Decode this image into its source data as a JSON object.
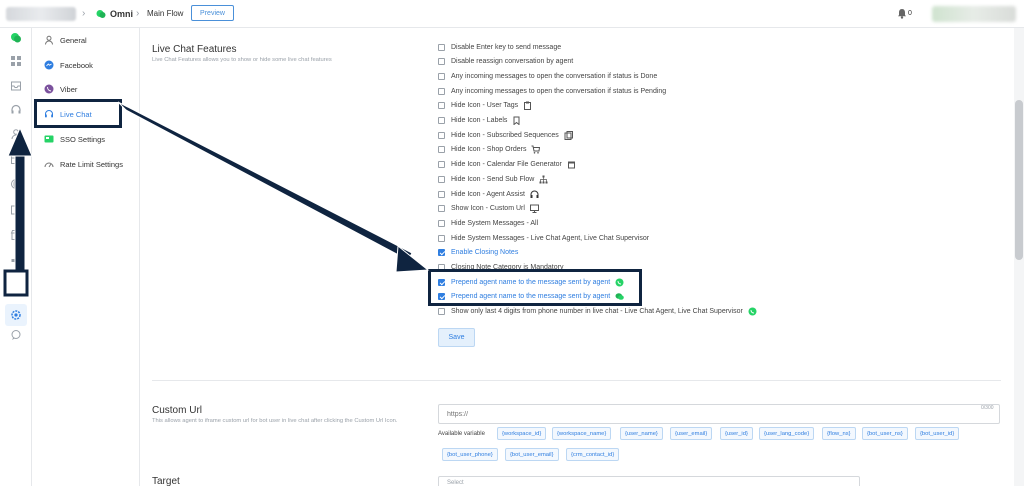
{
  "topbar": {
    "project": "Omni",
    "flow": "Main Flow",
    "preview_label": "Preview",
    "notification_count": "0"
  },
  "menu": {
    "items": [
      {
        "label": "General",
        "icon": "user-icon"
      },
      {
        "label": "Facebook",
        "icon": "messenger-icon"
      },
      {
        "label": "Viber",
        "icon": "viber-icon"
      },
      {
        "label": "Live Chat",
        "icon": "headset-icon",
        "active": true
      },
      {
        "label": "SSO Settings",
        "icon": "sso-icon"
      },
      {
        "label": "Rate Limit Settings",
        "icon": "gauge-icon"
      }
    ]
  },
  "live_chat": {
    "title": "Live Chat Features",
    "description": "Live Chat Features allows you to show or hide some live chat features",
    "options": [
      {
        "label": "Disable Enter key to send message",
        "checked": false
      },
      {
        "label": "Disable reassign conversation by agent",
        "checked": false
      },
      {
        "label": "Any incoming messages to open the conversation if status is Done",
        "checked": false
      },
      {
        "label": "Any incoming messages to open the conversation if status is Pending",
        "checked": false
      },
      {
        "label": "Hide Icon - User Tags",
        "checked": false,
        "icon": "clipboard-icon"
      },
      {
        "label": "Hide Icon - Labels",
        "checked": false,
        "icon": "bookmark-icon"
      },
      {
        "label": "Hide Icon - Subscribed Sequences",
        "checked": false,
        "icon": "sequence-icon"
      },
      {
        "label": "Hide Icon - Shop Orders",
        "checked": false,
        "icon": "cart-icon"
      },
      {
        "label": "Hide Icon - Calendar File Generator",
        "checked": false,
        "icon": "calendar-icon"
      },
      {
        "label": "Hide Icon - Send Sub Flow",
        "checked": false,
        "icon": "sitemap-icon"
      },
      {
        "label": "Hide Icon - Agent Assist",
        "checked": false,
        "icon": "agent-assist-icon"
      },
      {
        "label": "Show Icon - Custom Url",
        "checked": false,
        "icon": "monitor-icon"
      },
      {
        "label": "Hide System Messages - All",
        "checked": false
      },
      {
        "label": "Hide System Messages - Live Chat Agent, Live Chat Supervisor",
        "checked": false
      },
      {
        "label": "Enable Closing Notes",
        "checked": true
      },
      {
        "label": "Closing Note Category is Mandatory",
        "checked": false
      },
      {
        "label": "Prepend agent name to the message sent by agent",
        "checked": true,
        "icon": "whatsapp-icon"
      },
      {
        "label": "Prepend agent name to the message sent by agent",
        "checked": true,
        "icon": "wechat-icon"
      },
      {
        "label": "Show only last 4 digits from phone number in live chat - Live Chat Agent, Live Chat Supervisor",
        "checked": false,
        "icon": "whatsapp-icon"
      }
    ],
    "save_label": "Save"
  },
  "custom_url": {
    "title": "Custom Url",
    "description": "This allows agent to iframe custom url for bot user in live chat after clicking the Custom Url Icon.",
    "placeholder": "https://",
    "counter": "0/300",
    "available_label": "Available variable",
    "variables": [
      "{workspace_id}",
      "{workspace_name}",
      "{user_name}",
      "{user_email}",
      "{user_id}",
      "{user_lang_code}",
      "{flow_ns}",
      "{bot_user_ns}",
      "{bot_user_id}",
      "{bot_user_phone}",
      "{bot_user_email}",
      "{crm_contact_id}"
    ]
  },
  "target": {
    "title": "Target",
    "placeholder": "Select"
  },
  "colors": {
    "accent": "#2f7ee0",
    "annotation": "#0f2440",
    "whatsapp": "#25d366"
  }
}
